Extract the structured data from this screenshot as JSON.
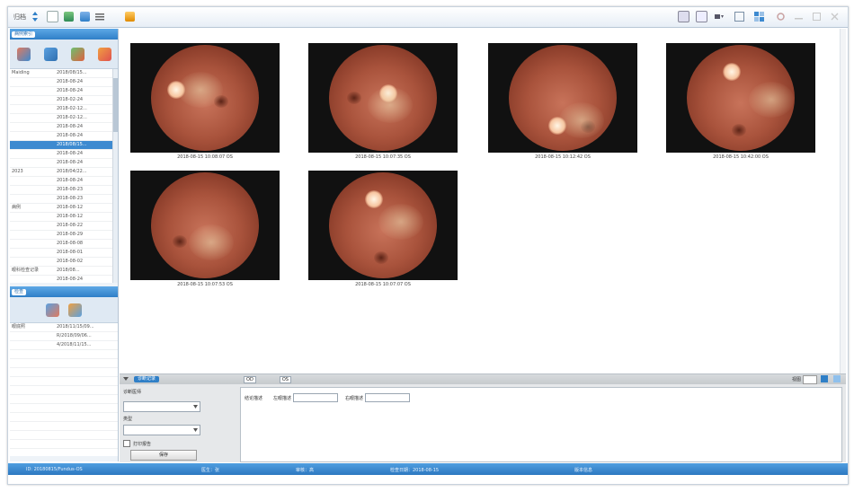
{
  "toolbar": {
    "left_label": "归档",
    "left_icons": [
      "sort-icon",
      "new-document-icon",
      "import-icon",
      "export-icon",
      "menu-icon",
      "tools-icon"
    ],
    "right_icons": [
      "print-icon",
      "print-preview-icon",
      "dropdown-icon",
      "layout-single-icon",
      "layout-grid-icon",
      "settings-icon",
      "minimize-icon",
      "maximize-icon",
      "close-icon"
    ]
  },
  "patient_panel": {
    "tag": "病例索引",
    "toolbar_icons": [
      "patient-icon",
      "person-icon",
      "refresh-icon",
      "add-icon"
    ],
    "rows": [
      [
        "Maiding",
        "2018/08/15..."
      ],
      [
        "",
        "2018-08-24"
      ],
      [
        "",
        "2018-08-24"
      ],
      [
        "",
        "2018-02-24"
      ],
      [
        "",
        "2018-02-12..."
      ],
      [
        "",
        "2018-02-12..."
      ],
      [
        "",
        "2018-08-24"
      ],
      [
        "",
        "2018-08-24"
      ],
      [
        "",
        "2018/08/15..."
      ],
      [
        "",
        "2018-08-24"
      ],
      [
        "",
        "2018-08-24"
      ],
      [
        "2023",
        "2018/04/22..."
      ],
      [
        "",
        "2018-08-24"
      ],
      [
        "",
        "2018-08-23"
      ],
      [
        "",
        "2018-08-23"
      ],
      [
        "病例",
        "2018-08-12"
      ],
      [
        "",
        "2018-08-12"
      ],
      [
        "",
        "2018-08-22"
      ],
      [
        "",
        "2018-08-29"
      ],
      [
        "",
        "2018-08-08"
      ],
      [
        "",
        "2018-08-01"
      ],
      [
        "",
        "2018-08-02"
      ],
      [
        "眼科检查记录",
        "2018/08..."
      ],
      [
        "",
        "2018-08-24"
      ]
    ],
    "selected_index": 8
  },
  "exam_panel": {
    "tag": "检查",
    "toolbar_icons": [
      "camera-icon",
      "search-icon"
    ],
    "rows": [
      [
        "眼底照",
        "2018/11/15/09..."
      ],
      [
        "",
        "R/2018/09/06..."
      ],
      [
        "",
        "4/2018/11/15..."
      ]
    ]
  },
  "images": [
    {
      "caption": "2018-08-15 10:08:07 OS",
      "disc": "left"
    },
    {
      "caption": "2018-08-15 10:07:35 OS",
      "disc": "right"
    },
    {
      "caption": "2018-08-15 10:12:42 OS",
      "disc": "bottom"
    },
    {
      "caption": "2018-08-15 10:42:00 OS",
      "disc": "top"
    },
    {
      "caption": "2018-08-15 10:07:53 OS",
      "disc": "none"
    },
    {
      "caption": "2018-08-15 10:07:07 OS",
      "disc": "top"
    }
  ],
  "bottom_panel": {
    "tab_active": "诊断记录",
    "tab_b": "OD",
    "tab_c": "OS",
    "view_label": "视图",
    "diagnosis_label": "诊断医师",
    "diagnosis_value": "",
    "type_label": "类型",
    "type_value": "",
    "checkbox_label": "打印报告",
    "save_button": "保存",
    "result_label": "结论描述",
    "field_a_label": "左眼描述",
    "field_b_label": "右眼描述",
    "notes_value": ""
  },
  "statusbar": {
    "path": "ID: 20180815/Fundus-OS",
    "doctor": "医生：张",
    "reviewer": "审核：高",
    "date_label": "检查日期：2018-08-15",
    "version": "版本信息"
  },
  "colors": {
    "accent": "#2f7fc7",
    "header_gradient_top": "#5ea8e6"
  }
}
